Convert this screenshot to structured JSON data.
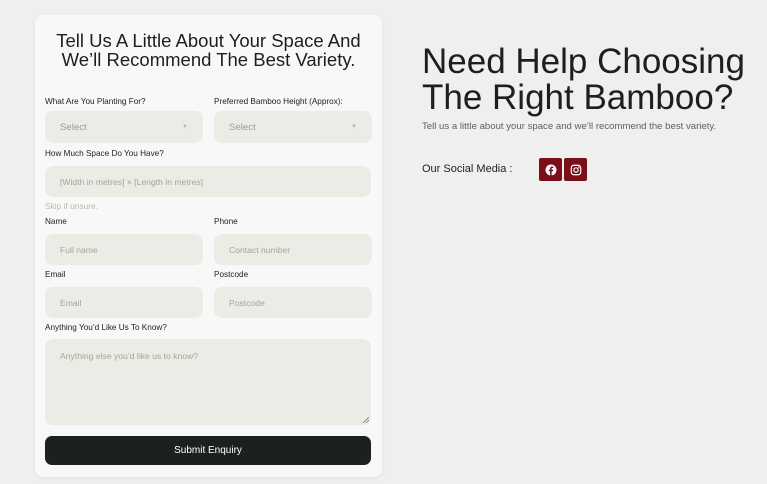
{
  "form": {
    "title": "Tell Us A Little About Your Space And We’ll Recommend The Best Variety.",
    "planting": {
      "label": "What Are You Planting For?",
      "value": "Select"
    },
    "height": {
      "label": "Preferred Bamboo Height (Approx):",
      "value": "Select"
    },
    "space": {
      "label": "How Much Space Do You Have?",
      "placeholder": "[Width in metres] × [Length in metres]",
      "hint": "Skip if unsure."
    },
    "name": {
      "label": "Name",
      "placeholder": "Full name"
    },
    "phone": {
      "label": "Phone",
      "placeholder": "Contact number"
    },
    "email": {
      "label": "Email",
      "placeholder": "Email"
    },
    "postcode": {
      "label": "Postcode",
      "placeholder": "Postcode"
    },
    "notes": {
      "label": "Anything You’d Like Us To Know?",
      "placeholder": "Anything else you’d like us to know?"
    },
    "submit_label": "Submit Enquiry"
  },
  "hero": {
    "title": "Need Help Choosing The Right Bamboo?",
    "subtitle": "Tell us a little about your space and we’ll recommend the best variety."
  },
  "social": {
    "label": "Our Social Media :",
    "icons": [
      "facebook-icon",
      "instagram-icon"
    ],
    "color": "#7a0f1a"
  },
  "colors": {
    "background": "#efefef",
    "card": "#f8f8f8",
    "field": "#ecebe5",
    "button": "#1c211f",
    "accent": "#7a0f1a"
  }
}
